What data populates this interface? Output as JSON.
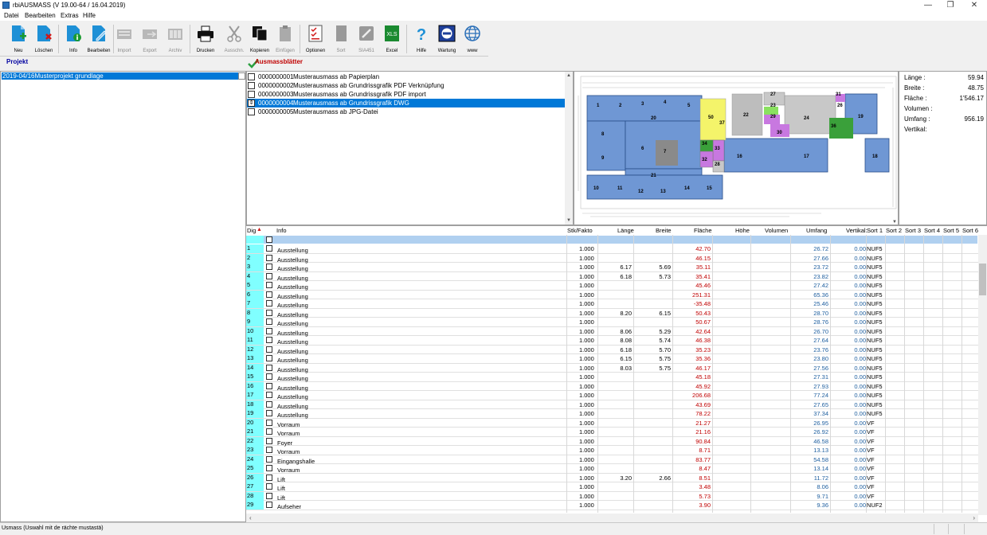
{
  "window": {
    "title": "rbiAUSMASS (V 19.00-64 / 16.04.2019)"
  },
  "menu": [
    "Datei",
    "Bearbeiten",
    "Extras",
    "Hilfe"
  ],
  "toolbar": [
    {
      "label": "Neu",
      "icon": "new-doc-icon",
      "enabled": true
    },
    {
      "label": "Löschen",
      "icon": "delete-doc-icon",
      "enabled": true
    },
    {
      "label": "Info",
      "icon": "info-doc-icon",
      "enabled": true
    },
    {
      "label": "Bearbeiten",
      "icon": "edit-doc-icon",
      "enabled": true
    },
    {
      "label": "Import",
      "icon": "import-icon",
      "enabled": false
    },
    {
      "label": "Export",
      "icon": "export-icon",
      "enabled": false
    },
    {
      "label": "Archiv",
      "icon": "archive-icon",
      "enabled": false
    },
    {
      "label": "Drucken",
      "icon": "printer-icon",
      "enabled": true
    },
    {
      "label": "Ausschn.",
      "icon": "scissors-icon",
      "enabled": false
    },
    {
      "label": "Kopieren",
      "icon": "copy-icon",
      "enabled": true
    },
    {
      "label": "Einfügen",
      "icon": "paste-icon",
      "enabled": false
    },
    {
      "label": "Optionen",
      "icon": "checklist-icon",
      "enabled": true
    },
    {
      "label": "Sort",
      "icon": "sort-icon",
      "enabled": false
    },
    {
      "label": "SIA451",
      "icon": "sia-icon",
      "enabled": false
    },
    {
      "label": "Excel",
      "icon": "excel-icon",
      "enabled": true
    },
    {
      "label": "Hilfe",
      "icon": "help-icon",
      "enabled": true
    },
    {
      "label": "Wartung",
      "icon": "maintenance-icon",
      "enabled": true
    },
    {
      "label": "www",
      "icon": "globe-icon",
      "enabled": true
    }
  ],
  "project": {
    "header": "Projekt",
    "selected": "2019-04/16Musterprojekt grundlage"
  },
  "sheets": {
    "header": "Ausmassblätter",
    "items": [
      {
        "nr": "0000000001",
        "name": "Musterausmass ab Papierplan"
      },
      {
        "nr": "0000000002",
        "name": "Musterausmass ab Grundrissgrafik PDF Verknüpfung"
      },
      {
        "nr": "0000000003",
        "name": "Musterausmass ab Grundrissgrafik PDF import"
      },
      {
        "nr": "0000000004",
        "name": "Musterausmass ab Grundrissgrafik DWG",
        "selected": true
      },
      {
        "nr": "0000000005",
        "name": "Musterausmass ab JPG-Datei"
      }
    ]
  },
  "info": [
    {
      "label": "Länge :",
      "value": "59.94"
    },
    {
      "label": "Breite :",
      "value": "48.75"
    },
    {
      "label": "Fläche :",
      "value": "1'546.17"
    },
    {
      "label": "Volumen :",
      "value": ""
    },
    {
      "label": "Umfang :",
      "value": "956.19"
    },
    {
      "label": "Vertikal:",
      "value": ""
    }
  ],
  "grid": {
    "columns": [
      "Dig",
      "Info",
      "Stk/Fakto",
      "Länge",
      "Breite",
      "Fläche",
      "Höhe",
      "Volumen",
      "Umfang",
      "Vertikal:",
      "Sort 1",
      "Sort 2",
      "Sort 3",
      "Sort 4",
      "Sort 5",
      "Sort 6"
    ],
    "rows": [
      {
        "dig": "1",
        "info": "Ausstellung",
        "stk": "1.000",
        "laenge": "",
        "breite": "",
        "flaeche": "42.70",
        "umfang": "26.72",
        "vertikal": "0.00",
        "sort1": "NUF5"
      },
      {
        "dig": "2",
        "info": "Ausstellung",
        "stk": "1.000",
        "laenge": "",
        "breite": "",
        "flaeche": "46.15",
        "umfang": "27.66",
        "vertikal": "0.00",
        "sort1": "NUF5"
      },
      {
        "dig": "3",
        "info": "Ausstellung",
        "stk": "1.000",
        "laenge": "6.17",
        "breite": "5.69",
        "flaeche": "35.11",
        "umfang": "23.72",
        "vertikal": "0.00",
        "sort1": "NUF5"
      },
      {
        "dig": "4",
        "info": "Ausstellung",
        "stk": "1.000",
        "laenge": "6.18",
        "breite": "5.73",
        "flaeche": "35.41",
        "umfang": "23.82",
        "vertikal": "0.00",
        "sort1": "NUF5"
      },
      {
        "dig": "5",
        "info": "Ausstellung",
        "stk": "1.000",
        "laenge": "",
        "breite": "",
        "flaeche": "45.46",
        "umfang": "27.42",
        "vertikal": "0.00",
        "sort1": "NUF5"
      },
      {
        "dig": "6",
        "info": "Ausstellung",
        "stk": "1.000",
        "laenge": "",
        "breite": "",
        "flaeche": "251.31",
        "umfang": "65.36",
        "vertikal": "0.00",
        "sort1": "NUF5"
      },
      {
        "dig": "7",
        "info": "Ausstellung",
        "stk": "1.000",
        "laenge": "",
        "breite": "",
        "flaeche": "-35.48",
        "umfang": "25.46",
        "vertikal": "0.00",
        "sort1": "NUF5"
      },
      {
        "dig": "8",
        "info": "Ausstellung",
        "stk": "1.000",
        "laenge": "8.20",
        "breite": "6.15",
        "flaeche": "50.43",
        "umfang": "28.70",
        "vertikal": "0.00",
        "sort1": "NUF5"
      },
      {
        "dig": "9",
        "info": "Ausstellung",
        "stk": "1.000",
        "laenge": "",
        "breite": "",
        "flaeche": "50.67",
        "umfang": "28.76",
        "vertikal": "0.00",
        "sort1": "NUF5"
      },
      {
        "dig": "10",
        "info": "Ausstellung",
        "stk": "1.000",
        "laenge": "8.06",
        "breite": "5.29",
        "flaeche": "42.64",
        "umfang": "26.70",
        "vertikal": "0.00",
        "sort1": "NUF5"
      },
      {
        "dig": "11",
        "info": "Ausstellung",
        "stk": "1.000",
        "laenge": "8.08",
        "breite": "5.74",
        "flaeche": "46.38",
        "umfang": "27.64",
        "vertikal": "0.00",
        "sort1": "NUF5"
      },
      {
        "dig": "12",
        "info": "Ausstellung",
        "stk": "1.000",
        "laenge": "6.18",
        "breite": "5.70",
        "flaeche": "35.23",
        "umfang": "23.76",
        "vertikal": "0.00",
        "sort1": "NUF5"
      },
      {
        "dig": "13",
        "info": "Ausstellung",
        "stk": "1.000",
        "laenge": "6.15",
        "breite": "5.75",
        "flaeche": "35.36",
        "umfang": "23.80",
        "vertikal": "0.00",
        "sort1": "NUF5"
      },
      {
        "dig": "14",
        "info": "Ausstellung",
        "stk": "1.000",
        "laenge": "8.03",
        "breite": "5.75",
        "flaeche": "46.17",
        "umfang": "27.56",
        "vertikal": "0.00",
        "sort1": "NUF5"
      },
      {
        "dig": "15",
        "info": "Ausstellung",
        "stk": "1.000",
        "laenge": "",
        "breite": "",
        "flaeche": "45.18",
        "umfang": "27.31",
        "vertikal": "0.00",
        "sort1": "NUF5"
      },
      {
        "dig": "16",
        "info": "Ausstellung",
        "stk": "1.000",
        "laenge": "",
        "breite": "",
        "flaeche": "45.92",
        "umfang": "27.93",
        "vertikal": "0.00",
        "sort1": "NUF5"
      },
      {
        "dig": "17",
        "info": "Ausstellung",
        "stk": "1.000",
        "laenge": "",
        "breite": "",
        "flaeche": "206.68",
        "umfang": "77.24",
        "vertikal": "0.00",
        "sort1": "NUF5"
      },
      {
        "dig": "18",
        "info": "Ausstellung",
        "stk": "1.000",
        "laenge": "",
        "breite": "",
        "flaeche": "43.69",
        "umfang": "27.65",
        "vertikal": "0.00",
        "sort1": "NUF5"
      },
      {
        "dig": "19",
        "info": "Ausstellung",
        "stk": "1.000",
        "laenge": "",
        "breite": "",
        "flaeche": "78.22",
        "umfang": "37.34",
        "vertikal": "0.00",
        "sort1": "NUF5"
      },
      {
        "dig": "20",
        "info": "Vorraum",
        "stk": "1.000",
        "laenge": "",
        "breite": "",
        "flaeche": "21.27",
        "umfang": "26.95",
        "vertikal": "0.00",
        "sort1": "VF"
      },
      {
        "dig": "21",
        "info": "Vorraum",
        "stk": "1.000",
        "laenge": "",
        "breite": "",
        "flaeche": "21.16",
        "umfang": "26.92",
        "vertikal": "0.00",
        "sort1": "VF"
      },
      {
        "dig": "22",
        "info": "Foyer",
        "stk": "1.000",
        "laenge": "",
        "breite": "",
        "flaeche": "90.84",
        "umfang": "46.58",
        "vertikal": "0.00",
        "sort1": "VF"
      },
      {
        "dig": "23",
        "info": "Vorraum",
        "stk": "1.000",
        "laenge": "",
        "breite": "",
        "flaeche": "8.71",
        "umfang": "13.13",
        "vertikal": "0.00",
        "sort1": "VF"
      },
      {
        "dig": "24",
        "info": "Eingangshalle",
        "stk": "1.000",
        "laenge": "",
        "breite": "",
        "flaeche": "83.77",
        "umfang": "54.58",
        "vertikal": "0.00",
        "sort1": "VF"
      },
      {
        "dig": "25",
        "info": "Vorraum",
        "stk": "1.000",
        "laenge": "",
        "breite": "",
        "flaeche": "8.47",
        "umfang": "13.14",
        "vertikal": "0.00",
        "sort1": "VF"
      },
      {
        "dig": "26",
        "info": "Lift",
        "stk": "1.000",
        "laenge": "3.20",
        "breite": "2.66",
        "flaeche": "8.51",
        "umfang": "11.72",
        "vertikal": "0.00",
        "sort1": "VF"
      },
      {
        "dig": "27",
        "info": "Lift",
        "stk": "1.000",
        "laenge": "",
        "breite": "",
        "flaeche": "3.48",
        "umfang": "8.06",
        "vertikal": "0.00",
        "sort1": "VF"
      },
      {
        "dig": "28",
        "info": "Lift",
        "stk": "1.000",
        "laenge": "",
        "breite": "",
        "flaeche": "5.73",
        "umfang": "9.71",
        "vertikal": "0.00",
        "sort1": "VF"
      },
      {
        "dig": "29",
        "info": "Aufseher",
        "stk": "1.000",
        "laenge": "",
        "breite": "",
        "flaeche": "3.90",
        "umfang": "9.36",
        "vertikal": "0.00",
        "sort1": "NUF2"
      }
    ]
  },
  "plan_rooms": [
    "1",
    "2",
    "3",
    "4",
    "5",
    "6",
    "7",
    "8",
    "9",
    "10",
    "11",
    "12",
    "13",
    "14",
    "15",
    "16",
    "17",
    "18",
    "19",
    "20",
    "21",
    "22",
    "23",
    "24",
    "26",
    "27",
    "28",
    "29",
    "30",
    "31",
    "32",
    "33",
    "34",
    "36",
    "37",
    "50"
  ],
  "status": "Usmass (Uswahl mit de rächte mustastä)"
}
